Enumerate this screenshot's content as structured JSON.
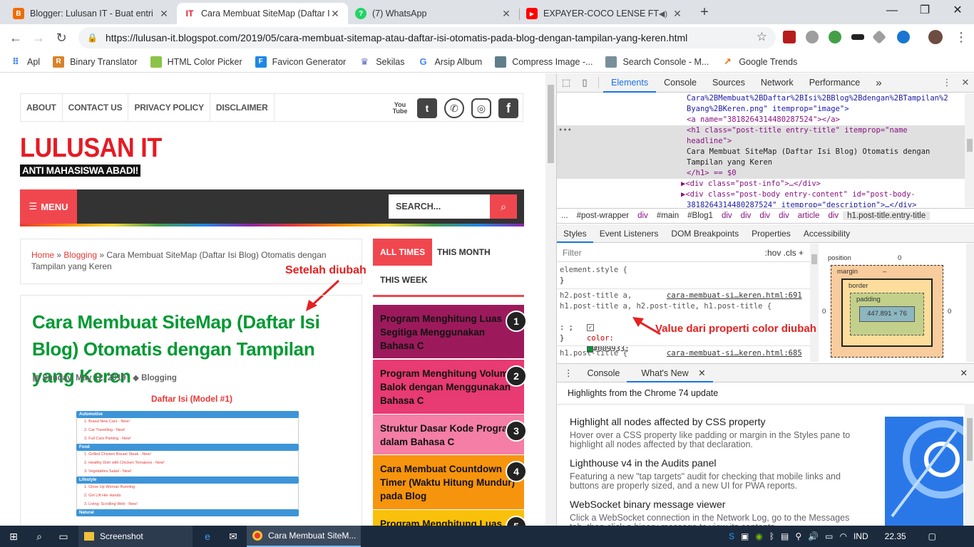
{
  "browser": {
    "tabs": [
      {
        "title": "Blogger: Lulusan IT - Buat entri",
        "favicon": "blogger-icon",
        "color": "#ef6c00",
        "glyph": "B",
        "close": "✕"
      },
      {
        "title": "Cara Membuat SiteMap (Daftar Isi",
        "favicon": "lulusan-it-icon",
        "color": "#e51b24",
        "glyph": "IT",
        "close": "✕"
      },
      {
        "title": "(7) WhatsApp",
        "favicon": "whatsapp-icon",
        "color": "#25d366",
        "glyph": "?",
        "close": "✕"
      },
      {
        "title": "EXPAYER-COCO LENSE FT M",
        "favicon": "youtube-icon",
        "color": "#ff0000",
        "glyph": "▶",
        "close": "✕"
      }
    ],
    "new_tab": "+",
    "window_controls": {
      "minimize": "—",
      "maximize": "❐",
      "close": "✕"
    },
    "nav": {
      "back": "←",
      "forward": "→",
      "reload": "↻"
    },
    "url": "https://lulusan-it.blogspot.com/2019/05/cara-membuat-sitemap-atau-daftar-isi-otomatis-pada-blog-dengan-tampilan-yang-keren.html",
    "bookmarks": [
      {
        "label": "Apl",
        "icon": "apps-grid-icon",
        "color": "#4285f4"
      },
      {
        "label": "Binary Translator",
        "icon": "binary-translator-icon",
        "color": "#d9822b"
      },
      {
        "label": "HTML Color Picker",
        "icon": "color-picker-icon",
        "color": "#8bc34a"
      },
      {
        "label": "Favicon Generator",
        "icon": "favicon-generator-icon",
        "color": "#1e88e5"
      },
      {
        "label": "Sekilas",
        "icon": "sekilas-icon",
        "color": "#5c6bc0"
      },
      {
        "label": "Arsip Album",
        "icon": "google-icon",
        "color": "#4285f4"
      },
      {
        "label": "Compress Image -...",
        "icon": "compress-image-icon",
        "color": "#607d8b"
      },
      {
        "label": "Search Console - M...",
        "icon": "search-console-icon",
        "color": "#78909c"
      },
      {
        "label": "Google Trends",
        "icon": "google-trends-icon",
        "color": "#ef6c00"
      }
    ]
  },
  "blog": {
    "nav": [
      "ABOUT",
      "CONTACT US",
      "PRIVACY POLICY",
      "DISCLAIMER"
    ],
    "social": [
      {
        "icon": "youtube-icon",
        "glyph": "You Tube"
      },
      {
        "icon": "twitter-icon",
        "glyph": "🐦"
      },
      {
        "icon": "whatsapp-icon",
        "glyph": "✆"
      },
      {
        "icon": "instagram-icon",
        "glyph": "◎"
      },
      {
        "icon": "facebook-icon",
        "glyph": "f"
      }
    ],
    "logo_title": "LULUSAN IT",
    "logo_tagline": "ANTI MAHASISWA ABADI!",
    "menu_label": "MENU",
    "search_placeholder": "SEARCH...",
    "breadcrumb": {
      "home": "Home",
      "sep1": " » ",
      "category": "Blogging",
      "sep2": " » ",
      "current": "Cara Membuat SiteMap (Daftar Isi Blog) Otomatis dengan Tampilan yang Keren"
    },
    "post_title": "Cara Membuat SiteMap (Daftar Isi Blog) Otomatis dengan Tampilan yang Keren",
    "post_title_color": "#009933",
    "post_date": "Sunday, May 12, 2019",
    "post_label": "Blogging",
    "toc_caption": "Daftar Isi (Model #1)",
    "toc": [
      {
        "header": "Automotive",
        "items": [
          "1. Brand New Cars - New!",
          "2. Car Travelling - New!",
          "3. Full Cars Parking - New!"
        ]
      },
      {
        "header": "Food",
        "items": [
          "1. Grilled Chicken Breast Steak - New!",
          "2. Healthy Dish with Chicken Tomatoes - New!",
          "3. Vegetables Salad - New!"
        ]
      },
      {
        "header": "Lifestyle",
        "items": [
          "1. Close Up Woman Running",
          "2. Girl Lift Her Hands",
          "3. Living: Scrolling Web - New!"
        ]
      },
      {
        "header": "Natural",
        "items": []
      }
    ],
    "annotation_after": "Setelah diubah",
    "annotation_value": "Value dari properti color diubah",
    "sidebar_tabs": [
      "ALL TIMES",
      "THIS MONTH",
      "THIS WEEK"
    ],
    "popular": [
      {
        "rank": "1",
        "title": "Program Menghitung Luas Segitiga Menggunakan Bahasa C",
        "color": "#9c1a5c"
      },
      {
        "rank": "2",
        "title": "Program Menghitung Volume Balok dengan Menggunakan Bahasa C",
        "color": "#e83a73"
      },
      {
        "rank": "3",
        "title": "Struktur Dasar Kode Program dalam Bahasa C",
        "color": "#f47ea6"
      },
      {
        "rank": "4",
        "title": "Cara Membuat Countdown Timer (Waktu Hitung Mundur) pada Blog",
        "color": "#f7940e"
      },
      {
        "rank": "5",
        "title": "Program Menghitung Luas",
        "color": "#f9c10c"
      }
    ]
  },
  "devtools": {
    "tabs": [
      "Elements",
      "Console",
      "Sources",
      "Network",
      "Performance"
    ],
    "more": "»",
    "dom_lines": [
      "Cara%2BMembuat%2BDaftar%2BIsi%2BBlog%2Bdengan%2BTampilan%2",
      "Byang%2BKeren.png\" itemprop=\"image\">",
      "<a name=\"3818264314480287524\"></a>",
      "<h1 class=\"post-title entry-title\" itemprop=\"name",
      "headline\">",
      "Cara Membuat SiteMap (Daftar Isi Blog) Otomatis dengan",
      "Tampilan yang Keren",
      "</h1> == $0",
      "▶<div class=\"post-info\">…</div>",
      "▶<div class=\"post-body entry-content\" id=\"post-body-",
      "3818264314480287524\" itemprop=\"description\">…</div>"
    ],
    "breadcrumbs": [
      "...",
      "#post-wrapper",
      "div",
      "#main",
      "#Blog1",
      "div",
      "div",
      "div",
      "div",
      "article",
      "div",
      "h1.post-title.entry-title"
    ],
    "subtabs": [
      "Styles",
      "Event Listeners",
      "DOM Breakpoints",
      "Properties",
      "Accessibility"
    ],
    "filter_placeholder": "Filter",
    "filter_right": ":hov  .cls  +",
    "element_style": "element.style {",
    "rule_selector1": "h2.post-title a,",
    "rule_source1": "cara-membuat-si…keren.html:691",
    "rule_selector2": "h1.post-title a, h2.post-title, h1.post-title {",
    "color_prop": "color:",
    "color_value": "#009933;",
    "rule_semicolon": ": ;",
    "close_brace": "}",
    "rule_selector3": "h1.post-title {",
    "rule_source3": "cara-membuat-si…keren.html:685",
    "box": {
      "position": "position",
      "margin": "margin",
      "border": "border",
      "padding": "padding",
      "content": "447.891 × 76",
      "zero": "0",
      "dash": "–"
    },
    "drawer_tabs": [
      "Console",
      "What's New"
    ],
    "drawer_heading": "Highlights from the Chrome 74 update",
    "news": [
      {
        "title": "Highlight all nodes affected by CSS property",
        "desc": "Hover over a CSS property like padding or margin in the Styles pane to highlight all nodes affected by that declaration."
      },
      {
        "title": "Lighthouse v4 in the Audits panel",
        "desc": "Featuring a new \"tap targets\" audit for checking that mobile links and buttons are properly sized, and a new UI for PWA reports."
      },
      {
        "title": "WebSocket binary message viewer",
        "desc": "Click a WebSocket connection in the Network Log, go to the Messages tab, then click a binary message to view its contents."
      }
    ]
  },
  "taskbar": {
    "apps": [
      "Screenshot",
      "Cara Membuat SiteM..."
    ],
    "lang": "IND",
    "time": "22.35"
  }
}
